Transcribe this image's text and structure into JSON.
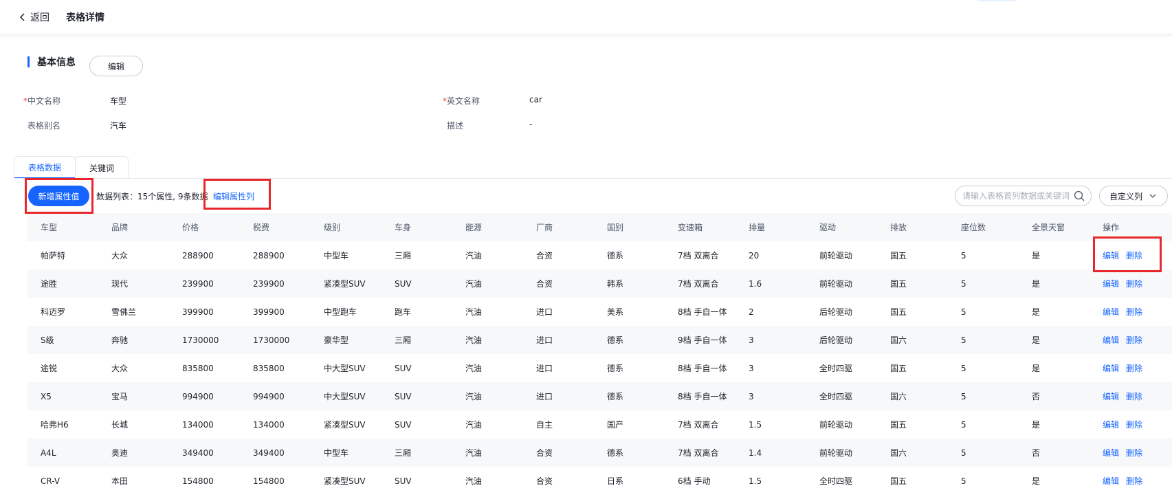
{
  "header": {
    "back_label": "返回",
    "title": "表格详情"
  },
  "basic": {
    "title": "基本信息",
    "edit_label": "编辑",
    "cn_name_label": "中文名称",
    "cn_name_value": "车型",
    "en_name_label": "英文名称",
    "en_name_value": "car",
    "alias_label": "表格别名",
    "alias_value": "汽车",
    "desc_label": "描述",
    "desc_value": "-",
    "required_mark": "*"
  },
  "tabs": [
    {
      "label": "表格数据"
    },
    {
      "label": "关键词"
    }
  ],
  "toolbar": {
    "add_label": "新增属性值",
    "list_info": "数据列表：15个属性, 9条数据",
    "edit_cols_label": "编辑属性列",
    "search_placeholder": "请输入表格首列数据或关键词",
    "custom_cols_label": "自定义列"
  },
  "table": {
    "columns": [
      "车型",
      "品牌",
      "价格",
      "税费",
      "级别",
      "车身",
      "能源",
      "厂商",
      "国别",
      "变速箱",
      "排量",
      "驱动",
      "排放",
      "座位数",
      "全景天窗",
      "操作"
    ],
    "rows": [
      [
        "帕萨特",
        "大众",
        "288900",
        "288900",
        "中型车",
        "三厢",
        "汽油",
        "合资",
        "德系",
        "7档 双离合",
        "20",
        "前轮驱动",
        "国五",
        "5",
        "是"
      ],
      [
        "途胜",
        "现代",
        "239900",
        "239900",
        "紧凑型SUV",
        "SUV",
        "汽油",
        "合资",
        "韩系",
        "7档 双离合",
        "1.6",
        "前轮驱动",
        "国五",
        "5",
        "是"
      ],
      [
        "科迈罗",
        "雪佛兰",
        "399900",
        "399900",
        "中型跑车",
        "跑车",
        "汽油",
        "进口",
        "美系",
        "8档 手自一体",
        "2",
        "后轮驱动",
        "国五",
        "5",
        "是"
      ],
      [
        "S级",
        "奔驰",
        "1730000",
        "1730000",
        "豪华型",
        "三厢",
        "汽油",
        "进口",
        "德系",
        "9档 手自一体",
        "3",
        "后轮驱动",
        "国六",
        "5",
        "是"
      ],
      [
        "途锐",
        "大众",
        "835800",
        "835800",
        "中大型SUV",
        "SUV",
        "汽油",
        "进口",
        "德系",
        "8档 手自一体",
        "3",
        "全时四驱",
        "国五",
        "5",
        "是"
      ],
      [
        "X5",
        "宝马",
        "994900",
        "994900",
        "中大型SUV",
        "SUV",
        "汽油",
        "进口",
        "德系",
        "8档 手自一体",
        "3",
        "全时四驱",
        "国六",
        "5",
        "否"
      ],
      [
        "哈弗H6",
        "长城",
        "134000",
        "134000",
        "紧凑型SUV",
        "SUV",
        "汽油",
        "自主",
        "国产",
        "7档 双离合",
        "1.5",
        "前轮驱动",
        "国五",
        "5",
        "是"
      ],
      [
        "A4L",
        "奥迪",
        "349400",
        "349400",
        "中型车",
        "三厢",
        "汽油",
        "合资",
        "德系",
        "7档 双离合",
        "1.4",
        "前轮驱动",
        "国六",
        "5",
        "否"
      ],
      [
        "CR-V",
        "本田",
        "154800",
        "154800",
        "紧凑型SUV",
        "SUV",
        "汽油",
        "合资",
        "日系",
        "6档 手动",
        "1.5",
        "全时四驱",
        "国五",
        "5",
        "是"
      ]
    ],
    "op_edit": "编辑",
    "op_delete": "删除"
  },
  "colors": {
    "primary": "#1664ff",
    "highlight_box": "#e8262b",
    "required": "#f53f3f"
  }
}
